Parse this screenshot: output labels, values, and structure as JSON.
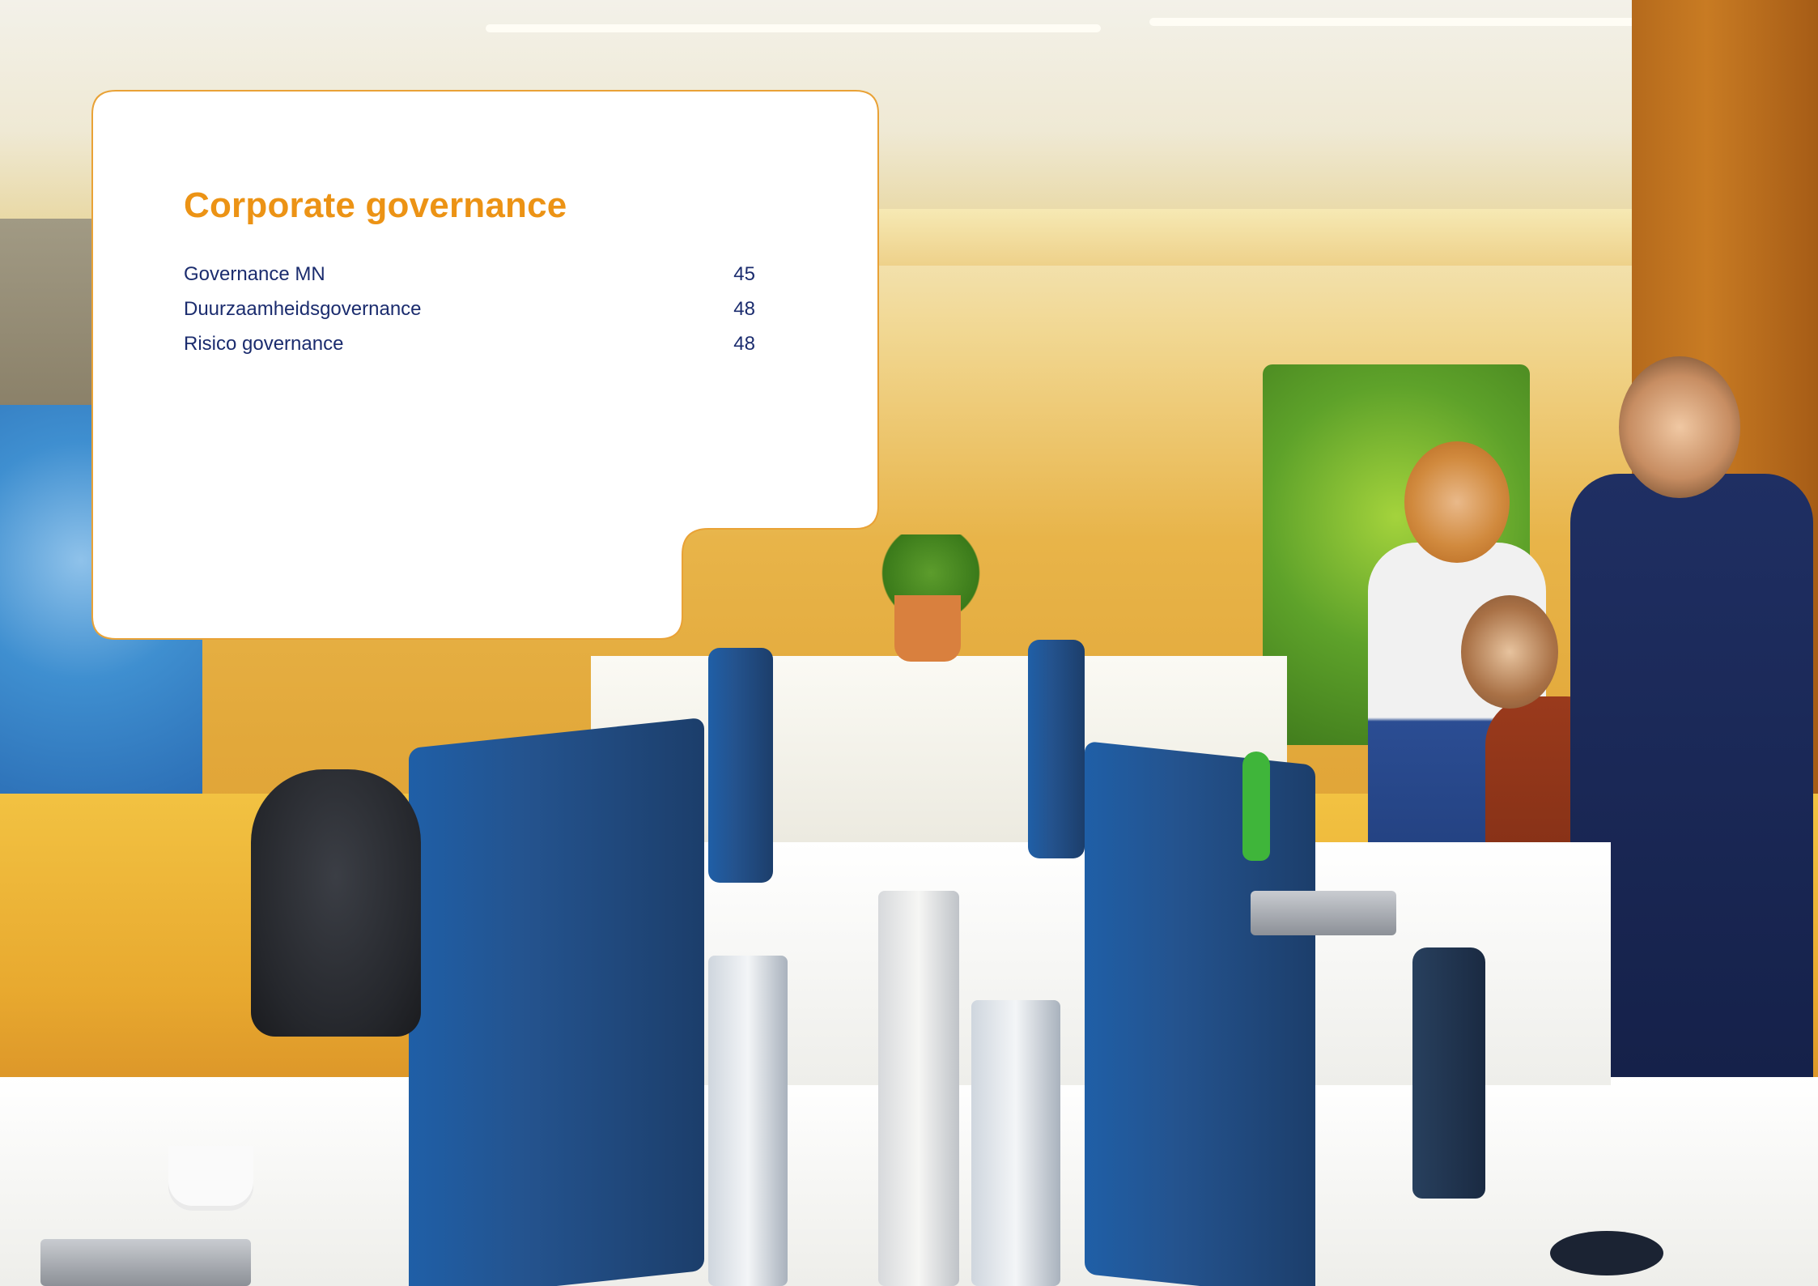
{
  "section": {
    "title": "Corporate governance",
    "toc": [
      {
        "label": "Governance MN",
        "page": "45"
      },
      {
        "label": "Duurzaamheidsgovernance",
        "page": "48"
      },
      {
        "label": "Risico governance",
        "page": "48"
      }
    ]
  },
  "colors": {
    "accent": "#ec9315",
    "text": "#1b2c6e",
    "card_background": "#ffffff",
    "card_border": "#e9a236"
  },
  "background": {
    "icon": "office-photo"
  }
}
